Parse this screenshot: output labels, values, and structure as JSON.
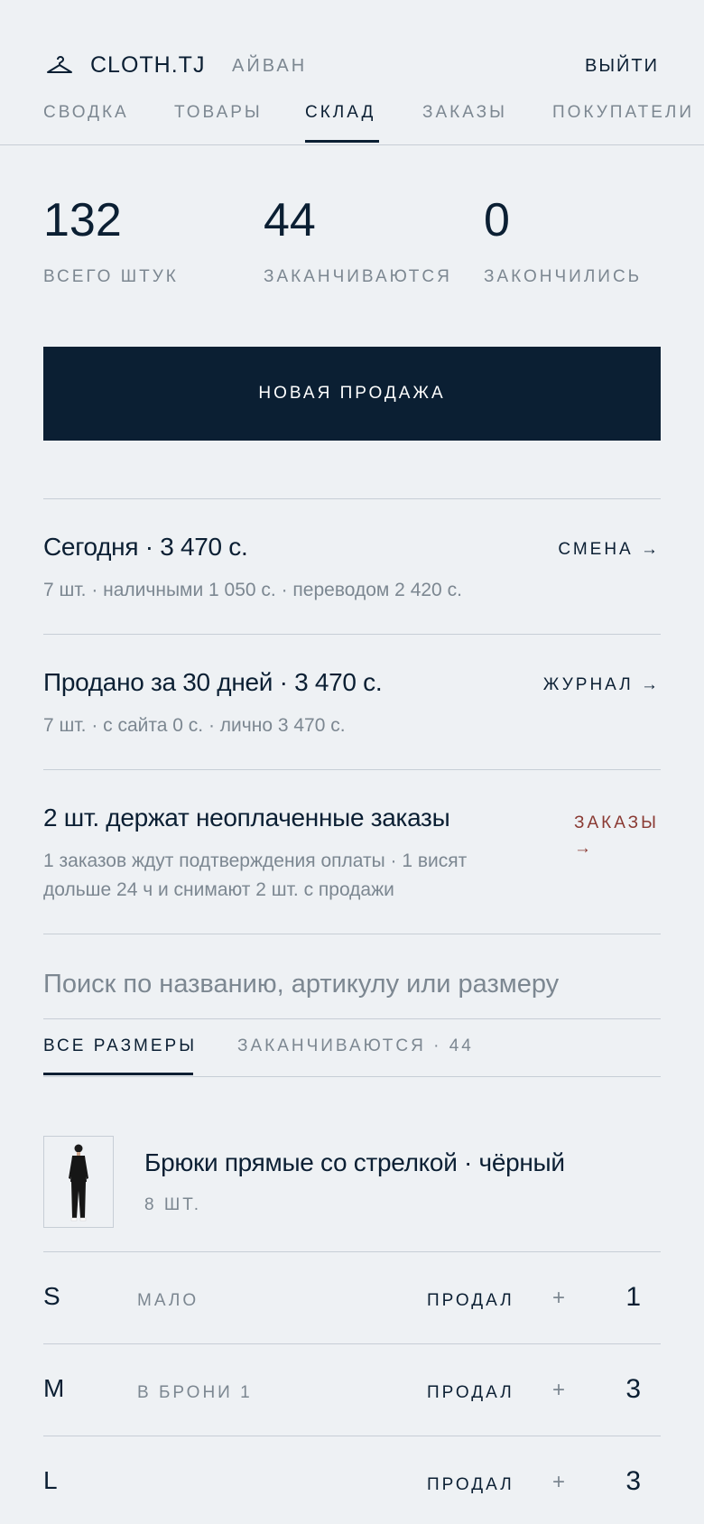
{
  "header": {
    "brand": "CLOTH.TJ",
    "user": "АЙВАН",
    "logout": "ВЫЙТИ",
    "logo_icon": "hanger-icon"
  },
  "nav": {
    "items": [
      "СВОДКА",
      "ТОВАРЫ",
      "СКЛАД",
      "ЗАКАЗЫ",
      "ПОКУПАТЕЛИ"
    ],
    "active": "СКЛАД"
  },
  "stats": [
    {
      "value": "132",
      "label": "ВСЕГО ШТУК"
    },
    {
      "value": "44",
      "label": "ЗАКАНЧИВАЮТСЯ"
    },
    {
      "value": "0",
      "label": "ЗАКОНЧИЛИСЬ"
    }
  ],
  "new_sale_label": "НОВАЯ ПРОДАЖА",
  "summaries": [
    {
      "title": "Сегодня · 3 470 с.",
      "subtitle": "7 шт. · наличными 1 050 с. · переводом 2 420 с.",
      "link": "СМЕНА →"
    },
    {
      "title": "Продано за 30 дней · 3 470 с.",
      "subtitle": "7 шт. · с сайта 0 с. · лично 3 470 с.",
      "link": "ЖУРНАЛ →"
    },
    {
      "title": "2 шт. держат неоплаченные заказы",
      "subtitle_line1": "1 заказов ждут подтверждения оплаты · 1 висят",
      "subtitle_line2": "дольше 24 ч и снимают 2 шт. с продажи",
      "link_line1": "ЗАКАЗЫ",
      "link_line2": "→",
      "link_color": "#8a3a33"
    }
  ],
  "search": {
    "placeholder": "Поиск по названию, артикулу или размеру",
    "value": ""
  },
  "filter_tabs": [
    {
      "label": "ВСЕ РАЗМЕРЫ",
      "active": true
    },
    {
      "label": "ЗАКАНЧИВАЮТСЯ · 44",
      "active": false
    }
  ],
  "product": {
    "name": "Брюки прямые со стрелкой · чёрный",
    "quantity": "8 ШТ.",
    "sizes": [
      {
        "size": "S",
        "note": "МАЛО",
        "sold_label": "ПРОДАЛ",
        "plus": "+",
        "count": "1"
      },
      {
        "size": "M",
        "note": "В БРОНИ 1",
        "sold_label": "ПРОДАЛ",
        "plus": "+",
        "count": "3"
      },
      {
        "size": "L",
        "note": "",
        "sold_label": "ПРОДАЛ",
        "plus": "+",
        "count": "3"
      }
    ]
  },
  "colors": {
    "primary": "#0b1f33",
    "muted": "#7c8791",
    "background": "#eef1f4",
    "divider": "#c7ced6",
    "alert": "#8a3a33"
  }
}
